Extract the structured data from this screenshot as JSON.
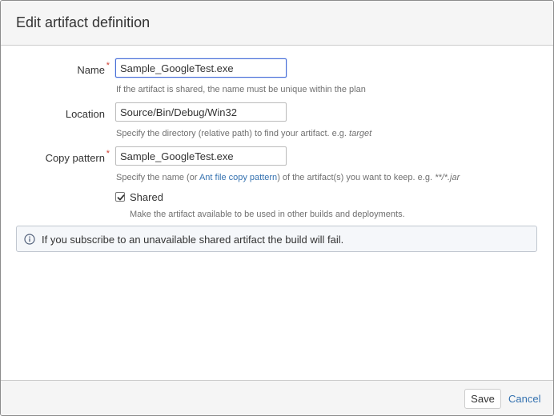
{
  "dialog": {
    "title": "Edit artifact definition"
  },
  "form": {
    "name": {
      "label": "Name",
      "required_mark": "*",
      "value": "Sample_GoogleTest.exe",
      "description": "If the artifact is shared, the name must be unique within the plan"
    },
    "location": {
      "label": "Location",
      "value": "Source/Bin/Debug/Win32",
      "description_prefix": "Specify the directory (relative path) to find your artifact. e.g. ",
      "description_example": "target"
    },
    "copy_pattern": {
      "label": "Copy pattern",
      "required_mark": "*",
      "value": "Sample_GoogleTest.exe",
      "description_prefix": "Specify the name (or ",
      "description_link": "Ant file copy pattern",
      "description_middle": ") of the artifact(s) you want to keep. e.g. ",
      "description_example": "**/*.jar"
    },
    "shared": {
      "label": "Shared",
      "checked": true,
      "description": "Make the artifact available to be used in other builds and deployments."
    }
  },
  "info_message": {
    "icon": "info-icon",
    "text": "If you subscribe to an unavailable shared artifact the build will fail."
  },
  "footer": {
    "save_label": "Save",
    "cancel_label": "Cancel"
  },
  "colors": {
    "required": "#d04437",
    "link": "#3572b0",
    "focus_border": "#4a6ed4"
  }
}
